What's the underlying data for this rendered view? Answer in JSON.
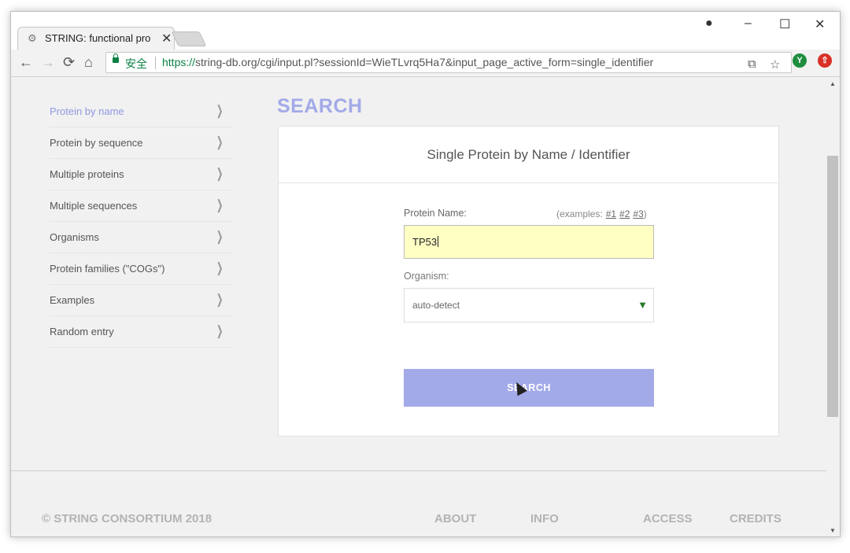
{
  "browser": {
    "tab_title": "STRING: functional pro",
    "tab_close": "✕",
    "window_controls": {
      "account": "●",
      "minimize": "–",
      "maximize": "☐",
      "close": "✕"
    },
    "nav": {
      "back": "←",
      "forward": "→",
      "reload": "⟳",
      "home": "⌂"
    },
    "secure_label": "安全",
    "url_scheme": "https://",
    "url_rest": "string-db.org/cgi/input.pl?sessionId=WieTLvrq5Ha7&input_page_active_form=single_identifier",
    "toolbar_icons": {
      "translate": "⧉",
      "bookmark": "☆"
    },
    "extensions": [
      {
        "name": "extension-green-icon",
        "glyph": "Y",
        "color": "#1e8e3e"
      },
      {
        "name": "extension-red-icon",
        "glyph": "⇧",
        "color": "#d93025"
      }
    ]
  },
  "sidebar": {
    "chevron": "❯",
    "items": [
      {
        "label": "Protein by name",
        "active": true
      },
      {
        "label": "Protein by sequence"
      },
      {
        "label": "Multiple proteins"
      },
      {
        "label": "Multiple sequences"
      },
      {
        "label": "Organisms"
      },
      {
        "label": "Protein families (\"COGs\")"
      },
      {
        "label": "Examples"
      },
      {
        "label": "Random entry"
      }
    ]
  },
  "main": {
    "heading": "SEARCH",
    "card_title": "Single Protein by Name / Identifier",
    "protein_label": "Protein Name:",
    "examples_prefix": "(examples:",
    "examples": [
      "#1",
      "#2",
      "#3"
    ],
    "examples_suffix": ")",
    "protein_value": "TP53",
    "organism_label": "Organism:",
    "organism_value": "auto-detect",
    "organism_arrow": "▼",
    "search_button": "SEARCH"
  },
  "footer": {
    "copyright": "© STRING CONSORTIUM 2018",
    "links": [
      "ABOUT",
      "INFO",
      "ACCESS",
      "CREDITS"
    ]
  },
  "colors": {
    "accent": "#a3aae8",
    "sidebar_active": "#8e99e0",
    "input_bg": "#ffffc4"
  }
}
